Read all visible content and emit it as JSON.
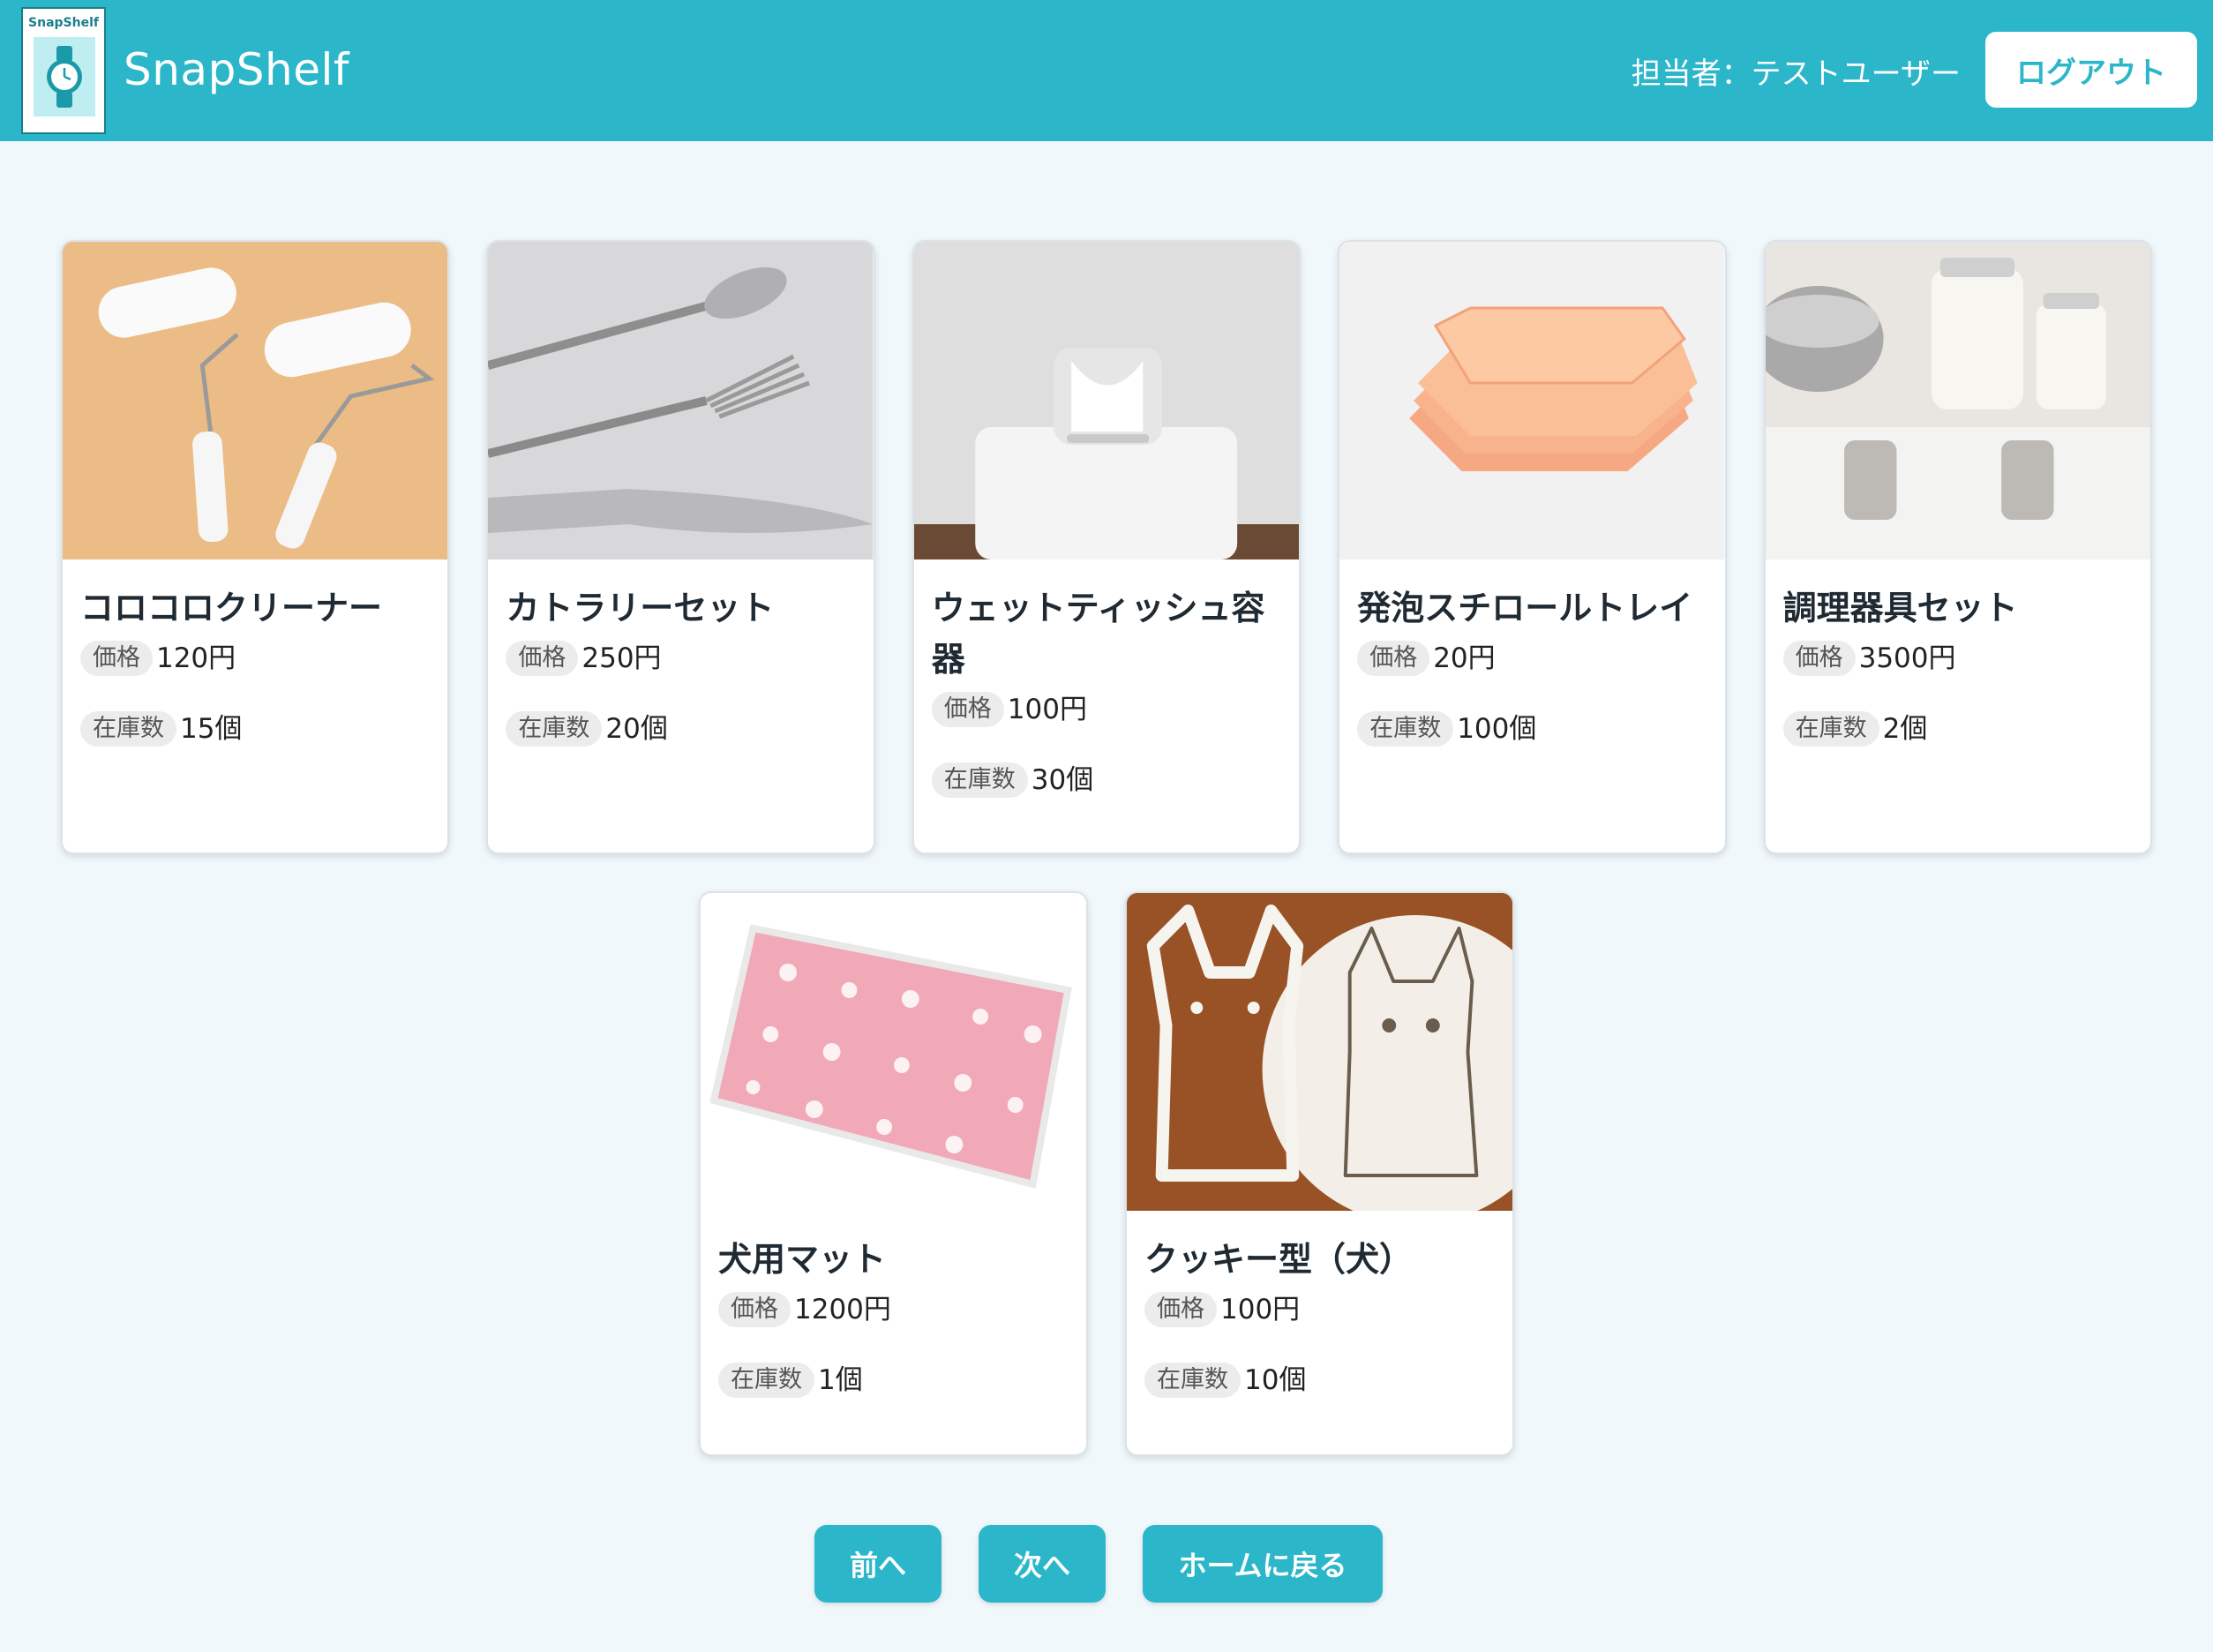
{
  "header": {
    "logo_text": "SnapShelf",
    "brand": "SnapShelf",
    "user_label": "担当者：テストユーザー",
    "logout_label": "ログアウト"
  },
  "labels": {
    "price": "価格",
    "stock": "在庫数"
  },
  "products": [
    {
      "name": "コロコロクリーナー",
      "price": "120円",
      "stock": "15個",
      "image": "lint-roller-photo"
    },
    {
      "name": "カトラリーセット",
      "price": "250円",
      "stock": "20個",
      "image": "cutlery-photo"
    },
    {
      "name": "ウェットティッシュ容器",
      "price": "100円",
      "stock": "30個",
      "image": "wet-tissue-case-photo"
    },
    {
      "name": "発泡スチロールトレイ",
      "price": "20円",
      "stock": "100個",
      "image": "foam-tray-photo"
    },
    {
      "name": "調理器具セット",
      "price": "3500円",
      "stock": "2個",
      "image": "kitchenware-photo"
    },
    {
      "name": "犬用マット",
      "price": "1200円",
      "stock": "1個",
      "image": "dog-mat-photo"
    },
    {
      "name": "クッキー型（犬）",
      "price": "100円",
      "stock": "10個",
      "image": "dog-cookie-cutter-photo"
    }
  ],
  "pagination": {
    "prev_label": "前へ",
    "next_label": "次へ",
    "home_label": "ホームに戻る"
  },
  "colors": {
    "accent": "#2bb6c9",
    "background": "#f0f8fc"
  }
}
